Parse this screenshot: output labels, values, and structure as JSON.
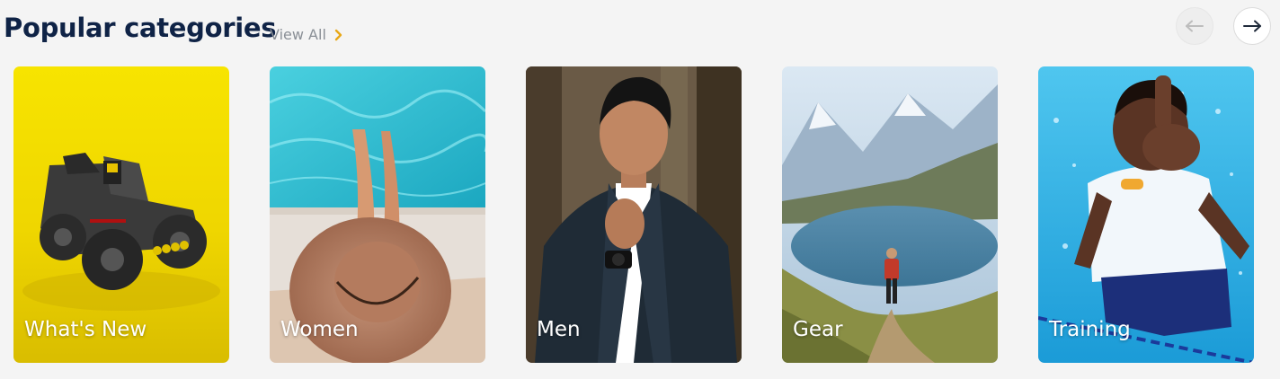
{
  "header": {
    "title": "Popular categories",
    "view_all_label": "View All"
  },
  "nav": {
    "prev_icon": "arrow-left-icon",
    "next_icon": "arrow-right-icon"
  },
  "categories": [
    {
      "label": "What's New",
      "image": "toy-batmobile-yellow-background"
    },
    {
      "label": "Women",
      "image": "woman-sunhat-pool"
    },
    {
      "label": "Men",
      "image": "man-dark-suit"
    },
    {
      "label": "Gear",
      "image": "hiker-mountain-lake"
    },
    {
      "label": "Training",
      "image": "child-swimming-thumbs-up"
    }
  ],
  "colors": {
    "title": "#0f2346",
    "view_all": "#8a8f96",
    "chevron_accent": "#e8a817"
  }
}
